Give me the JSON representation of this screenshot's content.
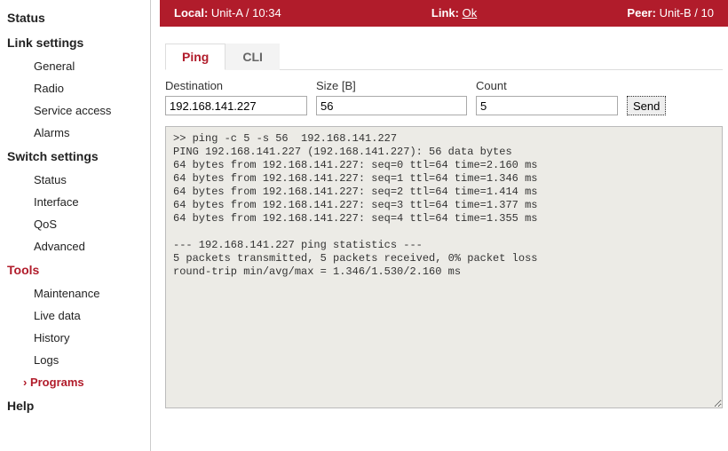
{
  "sidebar": {
    "status": "Status",
    "link_settings": "Link settings",
    "general": "General",
    "radio": "Radio",
    "service_access": "Service access",
    "alarms": "Alarms",
    "switch_settings": "Switch settings",
    "sw_status": "Status",
    "interface": "Interface",
    "qos": "QoS",
    "advanced": "Advanced",
    "tools": "Tools",
    "maintenance": "Maintenance",
    "live_data": "Live data",
    "history": "History",
    "logs": "Logs",
    "programs": "Programs",
    "help": "Help"
  },
  "statusbar": {
    "local_label": "Local:",
    "local_value": "Unit-A / 10:34",
    "link_label": "Link:",
    "link_value": "Ok",
    "peer_label": "Peer:",
    "peer_value": "Unit-B / 10"
  },
  "tabs": {
    "ping": "Ping",
    "cli": "CLI"
  },
  "form": {
    "destination_label": "Destination",
    "destination_value": "192.168.141.227",
    "size_label": "Size [B]",
    "size_value": "56",
    "count_label": "Count",
    "count_value": "5",
    "send_label": "Send"
  },
  "output": ">> ping -c 5 -s 56  192.168.141.227\nPING 192.168.141.227 (192.168.141.227): 56 data bytes\n64 bytes from 192.168.141.227: seq=0 ttl=64 time=2.160 ms\n64 bytes from 192.168.141.227: seq=1 ttl=64 time=1.346 ms\n64 bytes from 192.168.141.227: seq=2 ttl=64 time=1.414 ms\n64 bytes from 192.168.141.227: seq=3 ttl=64 time=1.377 ms\n64 bytes from 192.168.141.227: seq=4 ttl=64 time=1.355 ms\n\n--- 192.168.141.227 ping statistics ---\n5 packets transmitted, 5 packets received, 0% packet loss\nround-trip min/avg/max = 1.346/1.530/2.160 ms"
}
